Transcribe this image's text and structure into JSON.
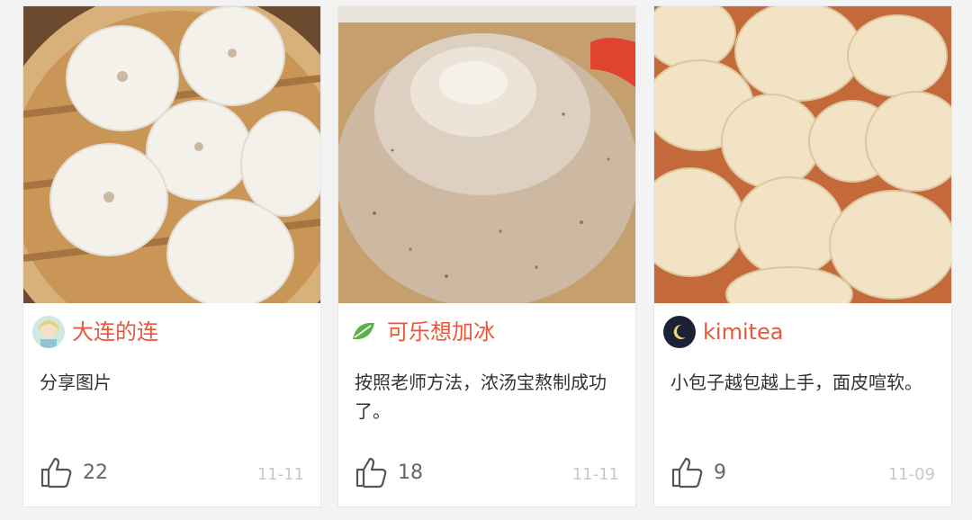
{
  "cards": [
    {
      "author": "大连的连",
      "text": "分享图片",
      "likes": "22",
      "date": "11-11",
      "avatar_icon": "cartoon-girl-avatar-icon"
    },
    {
      "author": "可乐想加冰",
      "text": "按照老师方法，浓汤宝熬制成功了。",
      "likes": "18",
      "date": "11-11",
      "avatar_icon": "green-leaf-avatar-icon"
    },
    {
      "author": "kimitea",
      "text": "小包子越包越上手，面皮喧软。",
      "likes": "9",
      "date": "11-09",
      "avatar_icon": "crescent-moon-avatar-icon"
    }
  ],
  "colors": {
    "author": "#e8573c",
    "date": "#c8c8c8",
    "text": "#333333",
    "like_icon": "#555555"
  }
}
